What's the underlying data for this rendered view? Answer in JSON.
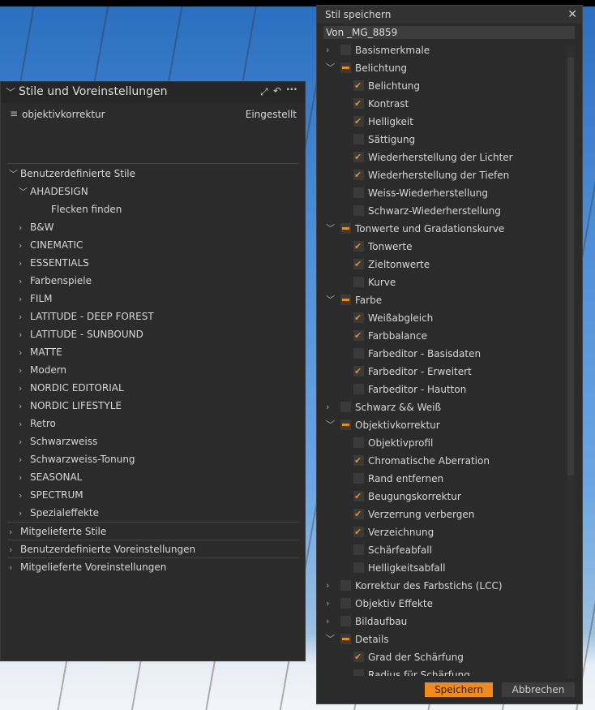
{
  "left_panel": {
    "title": "Stile und Voreinstellungen",
    "current_style": "objektivkorrektur",
    "status": "Eingestellt",
    "tree": [
      {
        "label": "Benutzerdefinierte Stile",
        "level": 0,
        "expand": "open"
      },
      {
        "label": "AHADESIGN",
        "level": 1,
        "expand": "open"
      },
      {
        "label": "Flecken finden",
        "level": 2,
        "expand": "none"
      },
      {
        "label": "B&W",
        "level": 1,
        "expand": "closed"
      },
      {
        "label": "CINEMATIC",
        "level": 1,
        "expand": "closed"
      },
      {
        "label": "ESSENTIALS",
        "level": 1,
        "expand": "closed"
      },
      {
        "label": "Farbenspiele",
        "level": 1,
        "expand": "closed"
      },
      {
        "label": "FILM",
        "level": 1,
        "expand": "closed"
      },
      {
        "label": "LATITUDE - DEEP FOREST",
        "level": 1,
        "expand": "closed"
      },
      {
        "label": "LATITUDE - SUNBOUND",
        "level": 1,
        "expand": "closed"
      },
      {
        "label": "MATTE",
        "level": 1,
        "expand": "closed"
      },
      {
        "label": "Modern",
        "level": 1,
        "expand": "closed"
      },
      {
        "label": "NORDIC EDITORIAL",
        "level": 1,
        "expand": "closed"
      },
      {
        "label": "NORDIC LIFESTYLE",
        "level": 1,
        "expand": "closed"
      },
      {
        "label": "Retro",
        "level": 1,
        "expand": "closed"
      },
      {
        "label": "Schwarzweiss",
        "level": 1,
        "expand": "closed"
      },
      {
        "label": "Schwarzweiss-Tonung",
        "level": 1,
        "expand": "closed"
      },
      {
        "label": "SEASONAL",
        "level": 1,
        "expand": "closed"
      },
      {
        "label": "SPECTRUM",
        "level": 1,
        "expand": "closed"
      },
      {
        "label": "Spezialeffekte",
        "level": 1,
        "expand": "closed"
      },
      {
        "label": "Mitgelieferte Stile",
        "level": 0,
        "expand": "closed",
        "sep": true
      },
      {
        "label": "Benutzerdefinierte Voreinstellungen",
        "level": 0,
        "expand": "closed",
        "sep": true
      },
      {
        "label": "Mitgelieferte Voreinstellungen",
        "level": 0,
        "expand": "closed",
        "sep": true
      }
    ]
  },
  "dialog": {
    "title": "Stil speichern",
    "name_value": "Von _MG_8859",
    "save_label": "Speichern",
    "cancel_label": "Abbrechen",
    "accent": "#f08a1e",
    "items": [
      {
        "label": "Basismerkmale",
        "level": 0,
        "expand": "closed",
        "state": "unchecked"
      },
      {
        "label": "Belichtung",
        "level": 0,
        "expand": "open",
        "state": "partial"
      },
      {
        "label": "Belichtung",
        "level": 1,
        "state": "checked"
      },
      {
        "label": "Kontrast",
        "level": 1,
        "state": "checked"
      },
      {
        "label": "Helligkeit",
        "level": 1,
        "state": "checked"
      },
      {
        "label": "Sättigung",
        "level": 1,
        "state": "unchecked"
      },
      {
        "label": "Wiederherstellung der Lichter",
        "level": 1,
        "state": "checked"
      },
      {
        "label": "Wiederherstellung der Tiefen",
        "level": 1,
        "state": "checked"
      },
      {
        "label": "Weiss-Wiederherstellung",
        "level": 1,
        "state": "unchecked"
      },
      {
        "label": "Schwarz-Wiederherstellung",
        "level": 1,
        "state": "unchecked"
      },
      {
        "label": "Tonwerte und Gradationskurve",
        "level": 0,
        "expand": "open",
        "state": "partial"
      },
      {
        "label": "Tonwerte",
        "level": 1,
        "state": "checked"
      },
      {
        "label": "Zieltonwerte",
        "level": 1,
        "state": "checked"
      },
      {
        "label": "Kurve",
        "level": 1,
        "state": "unchecked"
      },
      {
        "label": "Farbe",
        "level": 0,
        "expand": "open",
        "state": "partial"
      },
      {
        "label": "Weißabgleich",
        "level": 1,
        "state": "checked"
      },
      {
        "label": "Farbbalance",
        "level": 1,
        "state": "checked"
      },
      {
        "label": "Farbeditor - Basisdaten",
        "level": 1,
        "state": "unchecked"
      },
      {
        "label": "Farbeditor - Erweitert",
        "level": 1,
        "state": "checked"
      },
      {
        "label": "Farbeditor - Hautton",
        "level": 1,
        "state": "unchecked"
      },
      {
        "label": "Schwarz && Weiß",
        "level": 0,
        "expand": "closed",
        "state": "unchecked"
      },
      {
        "label": "Objektivkorrektur",
        "level": 0,
        "expand": "open",
        "state": "partial"
      },
      {
        "label": "Objektivprofil",
        "level": 1,
        "state": "unchecked"
      },
      {
        "label": "Chromatische Aberration",
        "level": 1,
        "state": "checked"
      },
      {
        "label": "Rand entfernen",
        "level": 1,
        "state": "unchecked"
      },
      {
        "label": "Beugungskorrektur",
        "level": 1,
        "state": "checked"
      },
      {
        "label": "Verzerrung verbergen",
        "level": 1,
        "state": "checked"
      },
      {
        "label": "Verzeichnung",
        "level": 1,
        "state": "checked"
      },
      {
        "label": "Schärfeabfall",
        "level": 1,
        "state": "unchecked"
      },
      {
        "label": "Helligkeitsabfall",
        "level": 1,
        "state": "unchecked"
      },
      {
        "label": "Korrektur des Farbstichs (LCC)",
        "level": 0,
        "expand": "closed",
        "state": "unchecked"
      },
      {
        "label": "Objektiv Effekte",
        "level": 0,
        "expand": "closed",
        "state": "unchecked"
      },
      {
        "label": "Bildaufbau",
        "level": 0,
        "expand": "closed",
        "state": "unchecked"
      },
      {
        "label": "Details",
        "level": 0,
        "expand": "open",
        "state": "partial"
      },
      {
        "label": "Grad der Schärfung",
        "level": 1,
        "state": "checked"
      },
      {
        "label": "Radius für Schärfung",
        "level": 1,
        "state": "unchecked"
      }
    ]
  }
}
